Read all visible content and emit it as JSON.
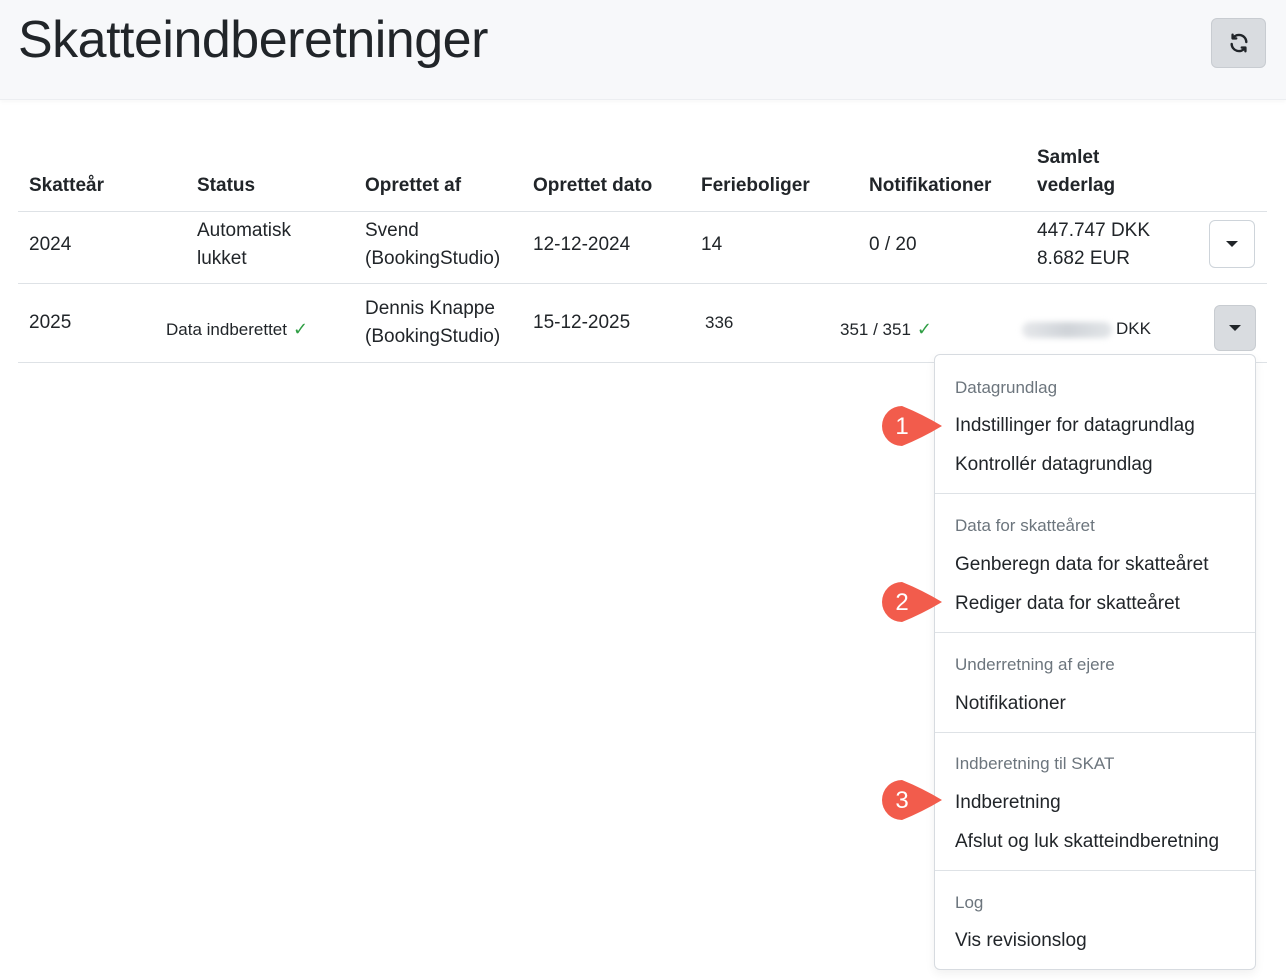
{
  "page": {
    "title": "Skatteindberetninger"
  },
  "toolbar": {
    "refresh_icon": "refresh-icon"
  },
  "table": {
    "headers": {
      "year": "Skatteår",
      "status": "Status",
      "created_by": "Oprettet af",
      "created_date": "Oprettet dato",
      "holiday_homes": "Ferieboliger",
      "notifications": "Notifikationer",
      "total_line1": "Samlet",
      "total_line2": "vederlag"
    },
    "rows": [
      {
        "year": "2024",
        "status_line1": "Automatisk",
        "status_line2": "lukket",
        "created_by_line1": "Svend",
        "created_by_line2": "(BookingStudio)",
        "created_date": "12-12-2024",
        "holiday_homes": "14",
        "notifications": "0 / 20",
        "total_line1": "447.747 DKK",
        "total_line2": "8.682 EUR"
      },
      {
        "year": "2025",
        "status": "Data indberettet",
        "created_by_line1": "Dennis Knappe",
        "created_by_line2": "(BookingStudio)",
        "created_date": "15-12-2025",
        "holiday_homes": "336",
        "notifications": "351 / 351",
        "total_currency": "DKK"
      }
    ]
  },
  "menu": {
    "sections": [
      {
        "header": "Datagrundlag",
        "items": [
          "Indstillinger for datagrundlag",
          "Kontrollér datagrundlag"
        ]
      },
      {
        "header": "Data for skatteåret",
        "items": [
          "Genberegn data for skatteåret",
          "Rediger data for skatteåret"
        ]
      },
      {
        "header": "Underretning af ejere",
        "items": [
          "Notifikationer"
        ]
      },
      {
        "header": "Indberetning til SKAT",
        "items": [
          "Indberetning",
          "Afslut og luk skatteindberetning"
        ]
      },
      {
        "header": "Log",
        "items": [
          "Vis revisionslog"
        ]
      }
    ]
  },
  "callouts": [
    "1",
    "2",
    "3"
  ],
  "colors": {
    "callout": "#f25c4c",
    "check": "#2f9e44",
    "header_bg": "#f7f8fa"
  }
}
